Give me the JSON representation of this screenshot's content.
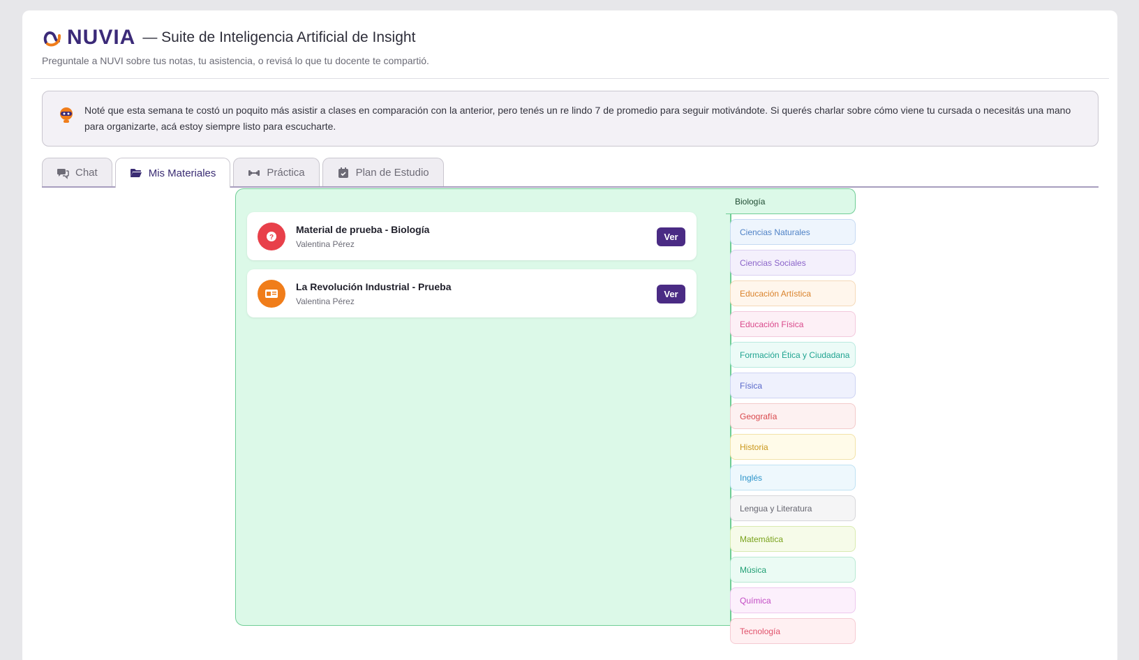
{
  "app": {
    "logo_text": "NUVIA",
    "title": "— Suite de Inteligencia Artificial de Insight",
    "subtitle": "Preguntale a NUVI sobre tus notas, tu asistencia, o revisá lo que tu docente te compartió."
  },
  "notice": {
    "text": "Noté que esta semana te costó un poquito más asistir a clases en comparación con la anterior, pero tenés un re lindo 7 de promedio para seguir motivándote. Si querés charlar sobre cómo viene tu cursada o necesitás una mano para organizarte, acá estoy siempre listo para escucharte.",
    "icon": "robot-icon"
  },
  "tabs": [
    {
      "label": "Chat",
      "icon": "chat-icon",
      "active": false
    },
    {
      "label": "Mis Materiales",
      "icon": "folder-open-icon",
      "active": true
    },
    {
      "label": "Práctica",
      "icon": "dumbbell-icon",
      "active": false
    },
    {
      "label": "Plan de Estudio",
      "icon": "calendar-icon",
      "active": false
    }
  ],
  "materials": [
    {
      "title": "Material de prueba - Biología",
      "author": "Valentina Pérez",
      "icon": "question-icon",
      "color": "#e8404a",
      "button": "Ver"
    },
    {
      "title": "La Revolución Industrial - Prueba",
      "author": "Valentina Pérez",
      "icon": "id-card-icon",
      "color": "#f07d1a",
      "button": "Ver"
    }
  ],
  "subjects": [
    {
      "label": "Biología",
      "active": true,
      "color": "#1d4a30",
      "bg": "#dcf9e8",
      "border": "#6fcd95"
    },
    {
      "label": "Ciencias Naturales",
      "color": "#4f82c6",
      "bg": "#eef5fd",
      "border": "#c6daf2"
    },
    {
      "label": "Ciencias Sociales",
      "color": "#8a63c9",
      "bg": "#f4f0fc",
      "border": "#dad0f1"
    },
    {
      "label": "Educación Artística",
      "color": "#d9822b",
      "bg": "#fff6ec",
      "border": "#f5d9b8"
    },
    {
      "label": "Educación Física",
      "color": "#d9478a",
      "bg": "#fdf0f6",
      "border": "#f3c9dc"
    },
    {
      "label": "Formación Ética y Ciudadana",
      "color": "#1fa390",
      "bg": "#ecfbf7",
      "border": "#b8eadf"
    },
    {
      "label": "Física",
      "color": "#5867c9",
      "bg": "#eff1fd",
      "border": "#cdd3f3"
    },
    {
      "label": "Geografía",
      "color": "#d9484c",
      "bg": "#fdf1f1",
      "border": "#f3caca"
    },
    {
      "label": "Historia",
      "color": "#c9961a",
      "bg": "#fffbe9",
      "border": "#f2e2a8"
    },
    {
      "label": "Inglés",
      "color": "#2b93c9",
      "bg": "#eef8fd",
      "border": "#bfe2f3"
    },
    {
      "label": "Lengua y Literatura",
      "color": "#666670",
      "bg": "#f5f5f6",
      "border": "#d6d6da"
    },
    {
      "label": "Matemática",
      "color": "#79a21c",
      "bg": "#f6fbe9",
      "border": "#d9ebb0"
    },
    {
      "label": "Música",
      "color": "#1f9e73",
      "bg": "#ebfbf4",
      "border": "#b8e9d3"
    },
    {
      "label": "Química",
      "color": "#c24bc4",
      "bg": "#fcf0fc",
      "border": "#edc8ee"
    },
    {
      "label": "Tecnología",
      "color": "#e0506a",
      "bg": "#fff0f2",
      "border": "#f5cad2"
    }
  ]
}
